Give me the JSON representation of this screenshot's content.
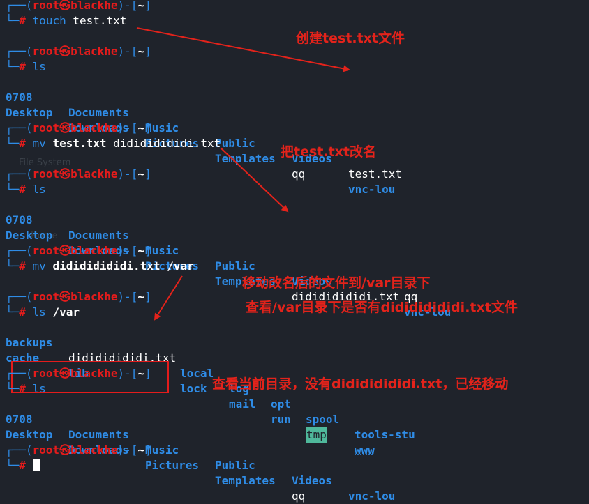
{
  "prompt": {
    "user": "root",
    "host": "blackhe",
    "dir": "~",
    "symbol": "#"
  },
  "blocks": [
    {
      "command": "touch",
      "args": "test.txt"
    },
    {
      "command": "ls"
    },
    {
      "command": "mv",
      "args_bold": "test.txt",
      "args": " didididididi.txt"
    },
    {
      "command": "ls"
    },
    {
      "command": "mv",
      "args_bold": "didididididi.txt /var"
    },
    {
      "command": "ls",
      "args_bold": "/var"
    },
    {
      "command": "ls"
    }
  ],
  "ls1": {
    "row1": [
      "0708",
      "Documents",
      "Music",
      "Public",
      "Videos",
      "test.txt"
    ],
    "row2": [
      "Desktop",
      "Downloads",
      "Pictures",
      "Templates",
      "qq",
      "vnc-lou"
    ]
  },
  "ls2": {
    "row1": [
      "0708",
      "Documents",
      "Music",
      "Public",
      "Videos",
      "qq"
    ],
    "row2": [
      "Desktop",
      "Downloads",
      "Pictures",
      "Templates",
      "didididididi.txt",
      "vnc-lou"
    ]
  },
  "ls3": {
    "row1": [
      "backups",
      "didididididi.txt",
      "local",
      "log",
      "opt",
      "spool",
      "tools-stu"
    ],
    "row2": [
      "cache",
      "lib",
      "lock",
      "mail",
      "run",
      "tmp",
      "www"
    ]
  },
  "ls4": {
    "row1": [
      "0708",
      "Documents",
      "Music",
      "Public",
      "Videos",
      "vnc-lou"
    ],
    "row2": [
      "Desktop",
      "Downloads",
      "Pictures",
      "Templates",
      "qq"
    ]
  },
  "annotations": {
    "a1": "创建test.txt文件",
    "a2": "把test.txt改名",
    "a3": "移动改名后的文件到/var目录下",
    "a4": "查看/var目录下是否有didididididi.txt文件",
    "a5": "查看当前目录，没有didididididi.txt，已经移动"
  },
  "background": {
    "file_system": "File System",
    "home": "Home"
  },
  "colors": {
    "background": "#1f232b",
    "blue": "#2f8ce6",
    "red": "#e31c1c",
    "annotation": "#e3231b",
    "tmp_bg": "#4fb89b"
  },
  "icons": {
    "skull": "kali-skull-icon",
    "cursor": "block-cursor"
  }
}
